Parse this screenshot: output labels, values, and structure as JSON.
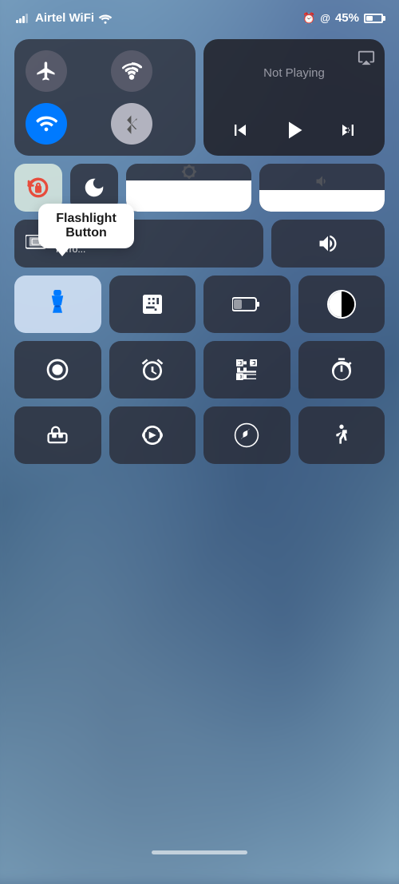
{
  "statusBar": {
    "carrier": "Airtel WiFi",
    "battery": "45%",
    "alarmIcon": "⏰",
    "locationIcon": "@"
  },
  "connectivity": {
    "airplaneLabel": "airplane-mode",
    "cellularLabel": "cellular",
    "wifiLabel": "wifi",
    "bluetoothLabel": "bluetooth"
  },
  "nowPlaying": {
    "text": "Not Playing"
  },
  "tooltip": {
    "line1": "Flashlight",
    "line2": "Button"
  },
  "screenMirror": {
    "label": "Screen\nMirror"
  },
  "homeIndicator": ""
}
